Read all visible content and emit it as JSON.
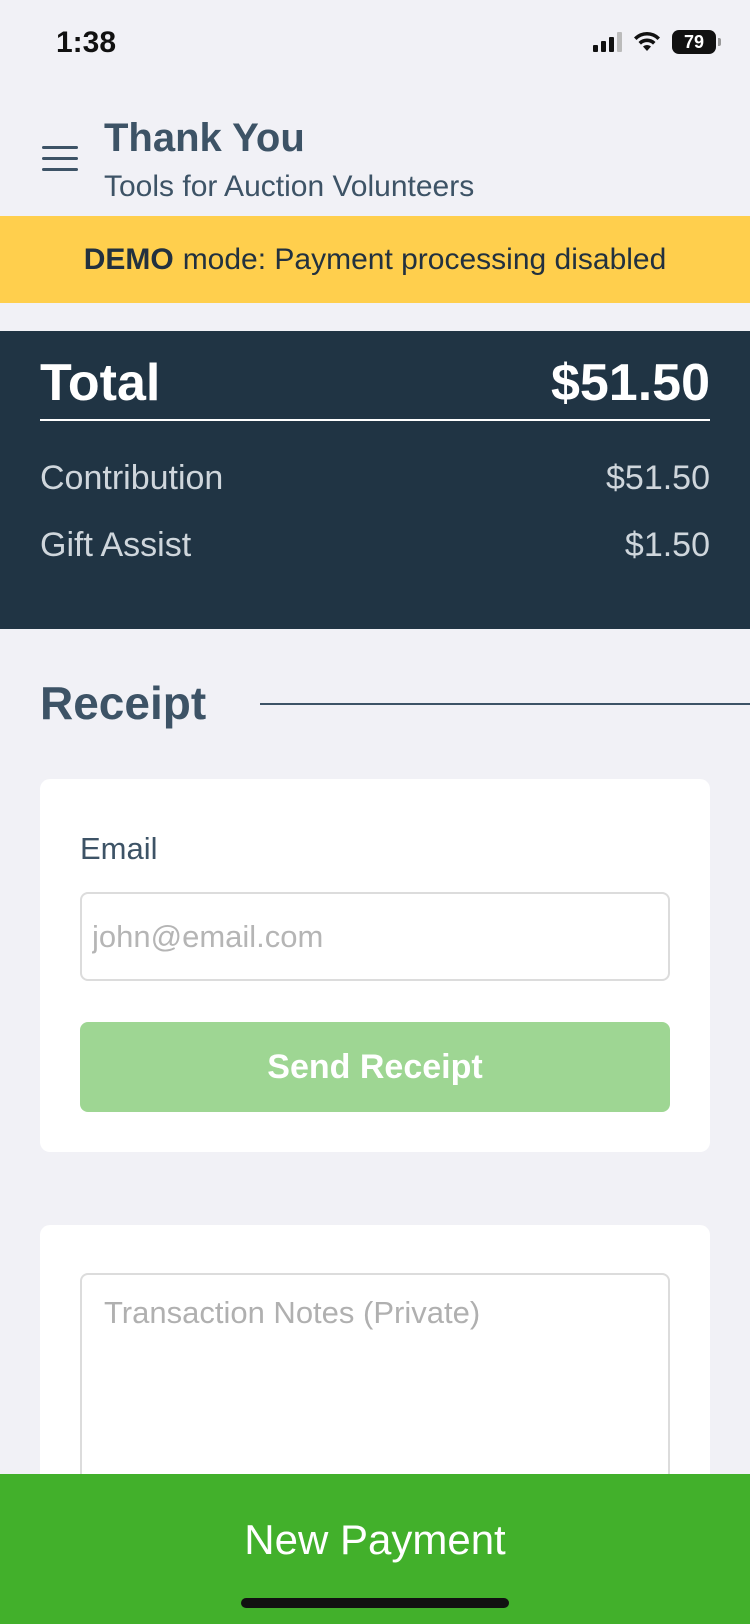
{
  "status_bar": {
    "time": "1:38",
    "battery": "79"
  },
  "header": {
    "title": "Thank You",
    "subtitle": "Tools for Auction Volunteers"
  },
  "demo_banner": {
    "strong": "DEMO",
    "text": "mode: Payment processing disabled"
  },
  "totals": {
    "total_label": "Total",
    "total_value": "$51.50",
    "rows": [
      {
        "label": "Contribution",
        "value": "$51.50"
      },
      {
        "label": "Gift Assist",
        "value": "$1.50"
      }
    ]
  },
  "receipt": {
    "heading": "Receipt",
    "email_label": "Email",
    "email_value": "",
    "email_placeholder": "john@email.com",
    "send_button": "Send Receipt"
  },
  "notes": {
    "placeholder": "Transaction Notes (Private)",
    "value": ""
  },
  "footer": {
    "new_payment": "New Payment"
  },
  "colors": {
    "banner": "#ffcf4d",
    "totals_bg": "#203444",
    "send_button_disabled": "#9ed693",
    "new_payment": "#42b02b",
    "heading_text": "#3d5366"
  },
  "icons": [
    "signal-icon",
    "wifi-icon",
    "battery-icon",
    "hamburger-menu-icon"
  ]
}
